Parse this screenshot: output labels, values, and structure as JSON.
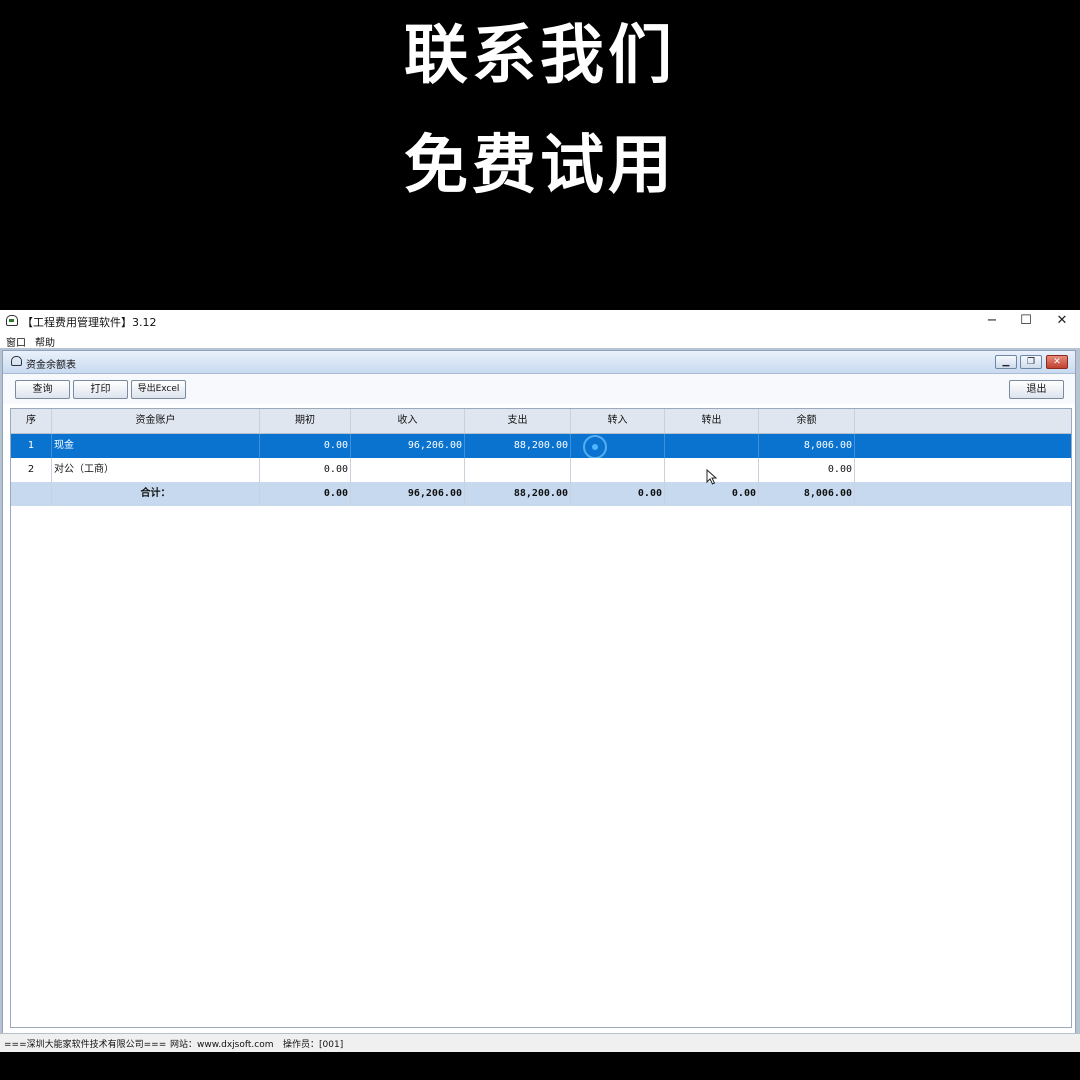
{
  "banner": {
    "line1": "联系我们",
    "line2": "免费试用"
  },
  "window": {
    "title": "【工程费用管理软件】3.12",
    "controls": {
      "minimize": "−",
      "maximize": "☐",
      "close": "✕"
    }
  },
  "menu": [
    "窗口",
    "帮助"
  ],
  "child": {
    "title": "资金余额表",
    "toolbar": {
      "query": "查询",
      "print": "打印",
      "export": "导出Excel",
      "exit": "退出"
    }
  },
  "table": {
    "headers": [
      "序",
      "资金账户",
      "期初",
      "收入",
      "支出",
      "转入",
      "转出",
      "余额"
    ],
    "rows": [
      {
        "no": "1",
        "account": "现金",
        "opening": "0.00",
        "income": "96,206.00",
        "expense": "88,200.00",
        "transfer_in": "",
        "transfer_out": "",
        "balance": "8,006.00"
      },
      {
        "no": "2",
        "account": "对公（工商）",
        "opening": "0.00",
        "income": "",
        "expense": "",
        "transfer_in": "",
        "transfer_out": "",
        "balance": "0.00"
      }
    ],
    "total": {
      "label": "合计：",
      "opening": "0.00",
      "income": "96,206.00",
      "expense": "88,200.00",
      "transfer_in": "0.00",
      "transfer_out": "0.00",
      "balance": "8,006.00"
    }
  },
  "status": {
    "company": "===深圳大能家软件技术有限公司===",
    "website": "网站：www.dxjsoft.com",
    "operator": "操作员：[001]"
  }
}
